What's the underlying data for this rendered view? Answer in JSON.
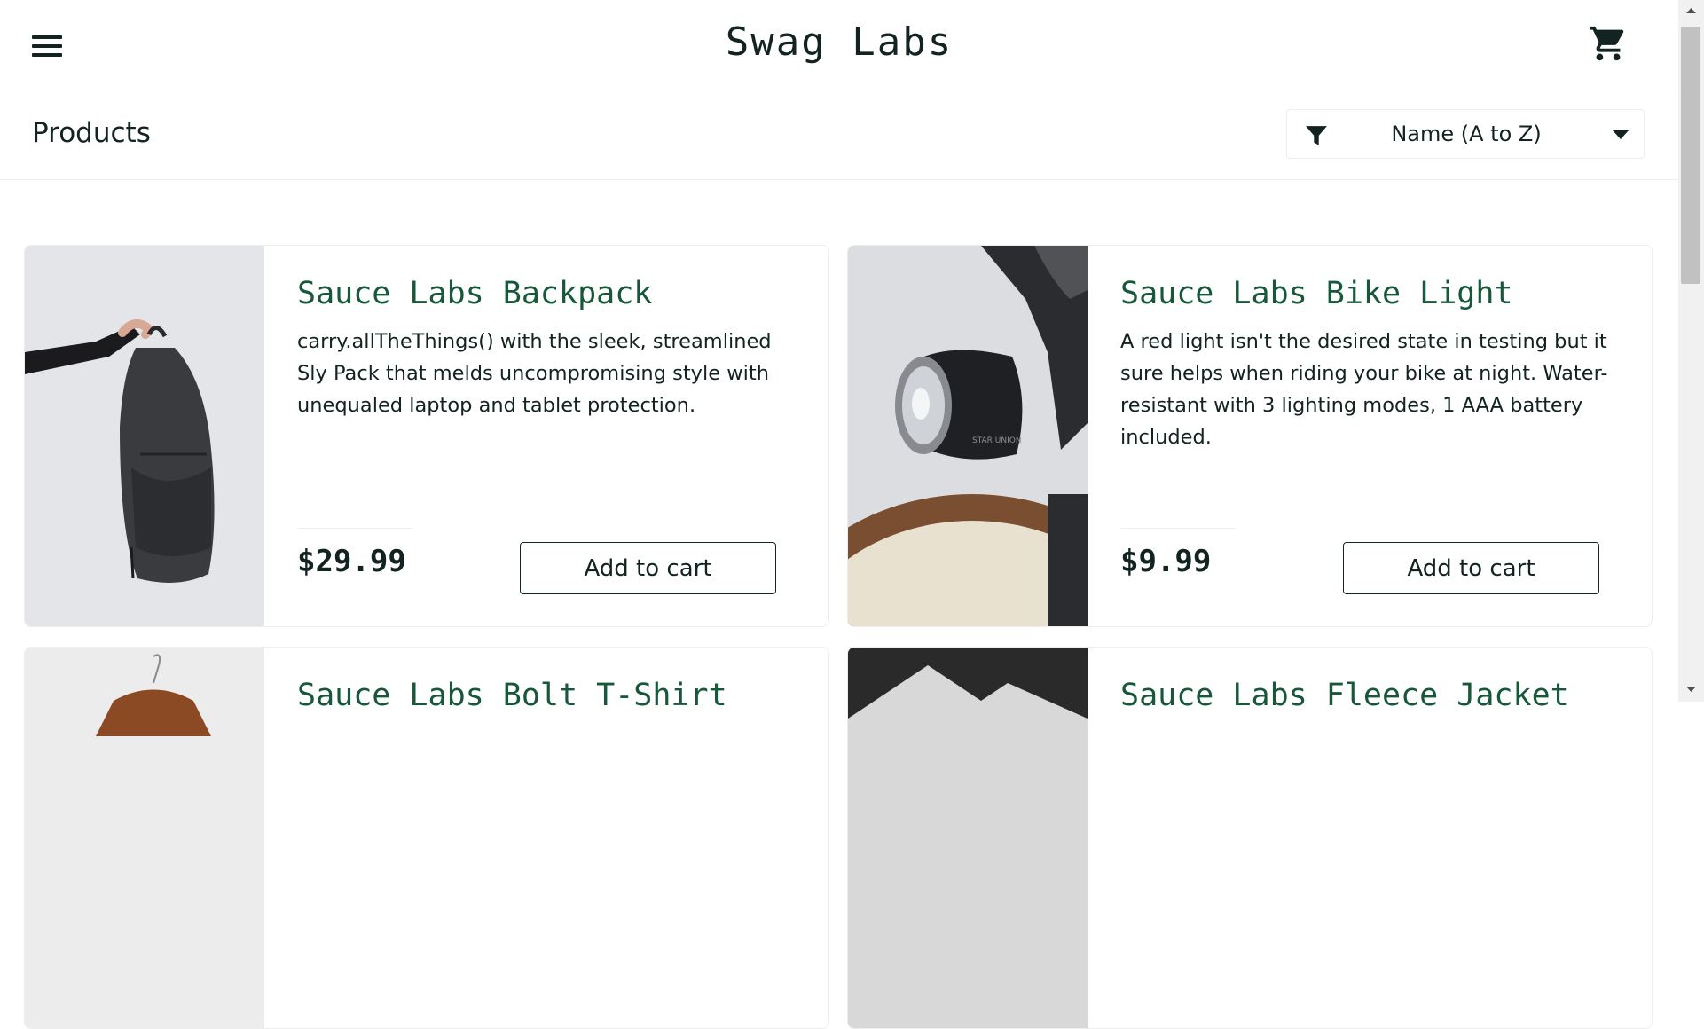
{
  "header": {
    "app_title": "Swag Labs",
    "menu_icon": "hamburger-menu-icon",
    "cart_icon": "shopping-cart-icon"
  },
  "subheader": {
    "title": "Products",
    "sort": {
      "icon": "filter-icon",
      "selected": "Name (A to Z)"
    }
  },
  "products": [
    {
      "name": "Sauce Labs Backpack",
      "description": "carry.allTheThings() with the sleek, streamlined Sly Pack that melds uncompromising style with unequaled laptop and tablet protection.",
      "price": "$29.99",
      "button_label": "Add to cart"
    },
    {
      "name": "Sauce Labs Bike Light",
      "description": "A red light isn't the desired state in testing but it sure helps when riding your bike at night. Water-resistant with 3 lighting modes, 1 AAA battery included.",
      "price": "$9.99",
      "button_label": "Add to cart"
    },
    {
      "name": "Sauce Labs Bolt T-Shirt"
    },
    {
      "name": "Sauce Labs Fleece Jacket"
    }
  ],
  "colors": {
    "product_name": "#18583a",
    "text": "#132322",
    "border": "#ededed"
  }
}
